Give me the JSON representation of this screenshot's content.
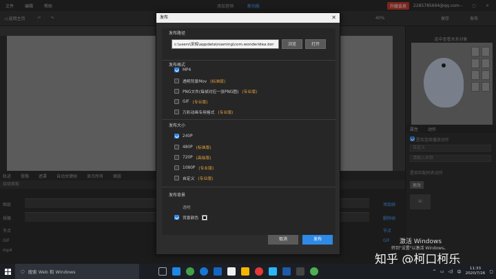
{
  "app": {
    "menu": [
      "文件",
      "编辑",
      "帮助"
    ],
    "center_left": "添加音频",
    "center_right": "新功能",
    "vip_label": "升级会员",
    "account": "2285785694@qq.com",
    "back_label": "返回主页",
    "zoom": "40%",
    "save_label": "保存",
    "publish_label": "发布"
  },
  "right_panel": {
    "title": "选中查看关系对象",
    "tab1": "属性",
    "tab2": "动作",
    "check_label": "是否连续播放动作",
    "field1": "自定义",
    "field2": "请输入名称",
    "note": "是否匹配同名动作",
    "btn": "更改",
    "ai_label": "AI"
  },
  "timeline": {
    "bar_items": [
      "轨迹",
      "骨骼",
      "遮罩",
      "自动关键帧",
      "显示所有",
      "缩放"
    ],
    "fps_label": "fps",
    "fps_value": "24",
    "head": "层级面板",
    "rows": [
      "图层",
      "骨骼",
      "节点",
      "GIF",
      "mp4"
    ],
    "right_btns": [
      "添加帧",
      "删除帧",
      "节点",
      "GIF"
    ]
  },
  "dialog": {
    "title": "发布",
    "path_section": "发布路径",
    "path_value": "c:\\users\\宋辉\\appdata\\roaming\\com.wonderidea.bor",
    "browse": "浏览",
    "open": "打开",
    "format_section": "发布格式",
    "formats": [
      {
        "label": "MP4",
        "tag": "",
        "checked": true
      },
      {
        "label": "透明背景Mov",
        "tag": "(标准版)",
        "checked": false
      },
      {
        "label": "PNG文件(每帧对应一张PNG图)",
        "tag": "(专业版)",
        "checked": false
      },
      {
        "label": "GIF",
        "tag": "(专业版)",
        "checked": false
      },
      {
        "label": "万彩动画专用格式",
        "tag": "(专业版)",
        "checked": false
      }
    ],
    "size_section": "发布大小",
    "sizes": [
      {
        "label": "240P",
        "tag": "",
        "checked": true
      },
      {
        "label": "480P",
        "tag": "(标准版)",
        "checked": false
      },
      {
        "label": "720P",
        "tag": "(高级版)",
        "checked": false
      },
      {
        "label": "1080P",
        "tag": "(专业版)",
        "checked": false
      },
      {
        "label": "自定义",
        "tag": "(专业版)",
        "checked": false
      }
    ],
    "bg_section": "发布背景",
    "bg_transparent": "透明",
    "bg_color": "背景颜色",
    "cancel": "取消",
    "confirm": "发布"
  },
  "windows": {
    "activate_title": "激活 Windows",
    "activate_sub": "转到\"设置\"以激活 Windows。",
    "watermark": "知乎 @柯口柯乐",
    "search_placeholder": "搜索 Web 和 Windows",
    "time": "11:33",
    "date": "2020/7/26",
    "lang": "中"
  }
}
